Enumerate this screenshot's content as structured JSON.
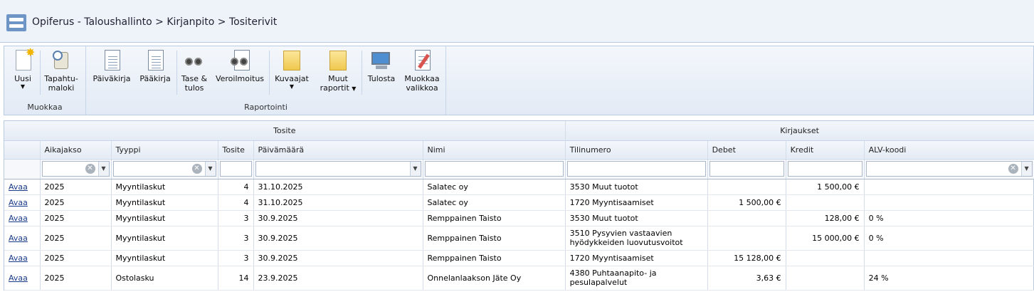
{
  "header": {
    "breadcrumb": "Opiferus - Taloushallinto > Kirjanpito > Tositerivit"
  },
  "ribbon": {
    "groups": {
      "muokkaa": "Muokkaa",
      "raportointi": "Raportointi"
    },
    "buttons": {
      "uusi": "Uusi",
      "tapahtumaloki_1": "Tapahtu-",
      "tapahtumaloki_2": "maloki",
      "paivakirja": "Päiväkirja",
      "paakirja": "Pääkirja",
      "tase_1": "Tase &",
      "tase_2": "tulos",
      "veroilmoitus": "Veroilmoitus",
      "kuvaajat": "Kuvaajat",
      "muut_1": "Muut",
      "muut_2": "raportit",
      "tulosta": "Tulosta",
      "muokkaa_1": "Muokkaa",
      "muokkaa_2": "valikkoa"
    }
  },
  "grid": {
    "groups": {
      "tosite": "Tosite",
      "kirjaukset": "Kirjaukset"
    },
    "columns": {
      "aikajakso": "Aikajakso",
      "tyyppi": "Tyyppi",
      "tosite": "Tosite",
      "paivamaara": "Päivämäärä",
      "nimi": "Nimi",
      "tilinumero": "Tilinumero",
      "debet": "Debet",
      "kredit": "Kredit",
      "alv": "ALV-koodi"
    },
    "rows": [
      {
        "link": "Avaa",
        "aikajakso": "2025",
        "tyyppi": "Myyntilaskut",
        "tosite": "4",
        "pvm": "31.10.2025",
        "nimi": "Salatec oy",
        "tili_1": "3530 Muut tuotot",
        "tili_2": "",
        "debet": "",
        "kredit": "1 500,00 €",
        "alv": ""
      },
      {
        "link": "Avaa",
        "aikajakso": "2025",
        "tyyppi": "Myyntilaskut",
        "tosite": "4",
        "pvm": "31.10.2025",
        "nimi": "Salatec oy",
        "tili_1": "1720 Myyntisaamiset",
        "tili_2": "",
        "debet": "1 500,00 €",
        "kredit": "",
        "alv": ""
      },
      {
        "link": "Avaa",
        "aikajakso": "2025",
        "tyyppi": "Myyntilaskut",
        "tosite": "3",
        "pvm": "30.9.2025",
        "nimi": "Remppainen Taisto",
        "tili_1": "3530 Muut tuotot",
        "tili_2": "",
        "debet": "",
        "kredit": "128,00 €",
        "alv": "0 %"
      },
      {
        "link": "Avaa",
        "aikajakso": "2025",
        "tyyppi": "Myyntilaskut",
        "tosite": "3",
        "pvm": "30.9.2025",
        "nimi": "Remppainen Taisto",
        "tili_1": "3510 Pysyvien vastaavien",
        "tili_2": "hyödykkeiden luovutusvoitot",
        "debet": "",
        "kredit": "15 000,00 €",
        "alv": "0 %"
      },
      {
        "link": "Avaa",
        "aikajakso": "2025",
        "tyyppi": "Myyntilaskut",
        "tosite": "3",
        "pvm": "30.9.2025",
        "nimi": "Remppainen Taisto",
        "tili_1": "1720 Myyntisaamiset",
        "tili_2": "",
        "debet": "15 128,00 €",
        "kredit": "",
        "alv": ""
      },
      {
        "link": "Avaa",
        "aikajakso": "2025",
        "tyyppi": "Ostolasku",
        "tosite": "14",
        "pvm": "23.9.2025",
        "nimi": "Onnelanlaakson Jäte Oy",
        "tili_1": "4380 Puhtaanapito- ja",
        "tili_2": "pesulapalvelut",
        "debet": "3,63 €",
        "kredit": "",
        "alv": "24 %"
      }
    ]
  }
}
